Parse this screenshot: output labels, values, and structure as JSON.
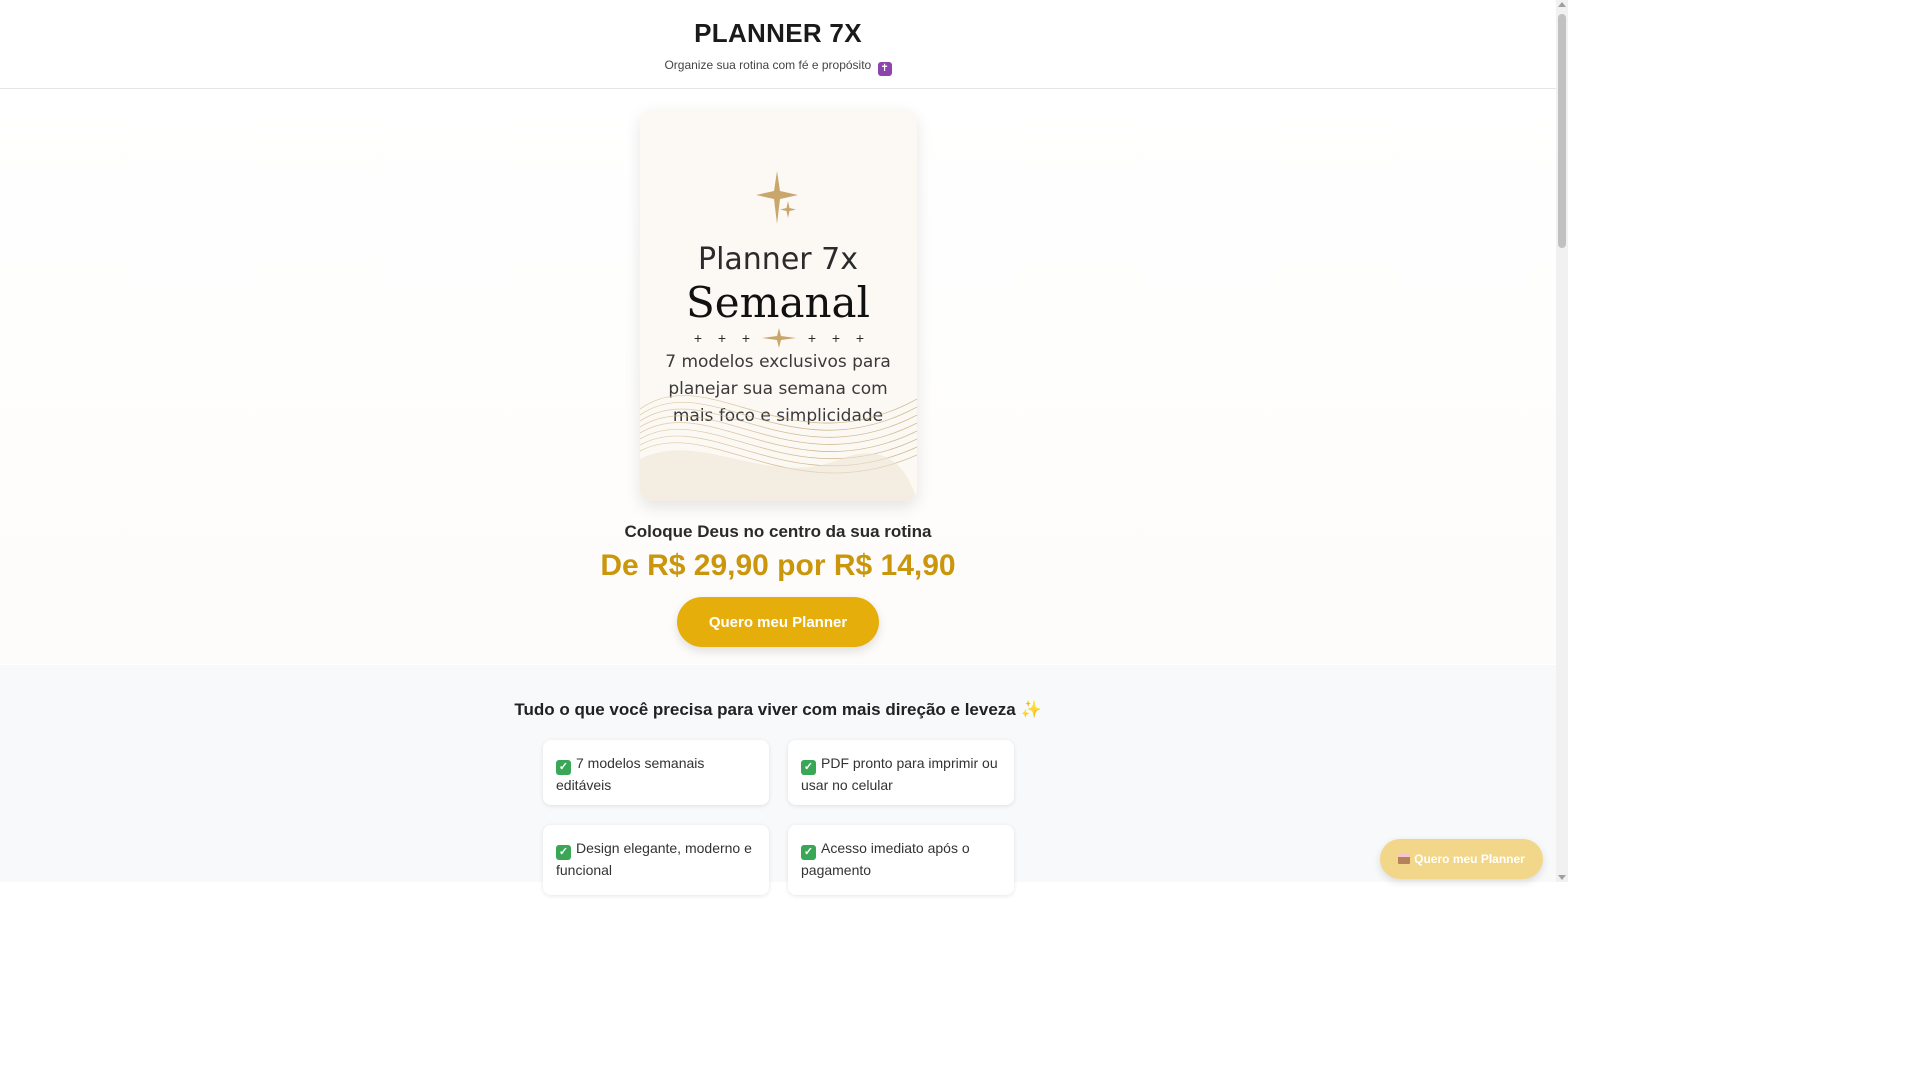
{
  "header": {
    "title": "PLANNER 7X",
    "subtitle": "Organize sua rotina com fé e propósito",
    "subtitle_icon": "latin-cross-icon"
  },
  "hero": {
    "cover": {
      "line1": "Planner 7x",
      "line2": "Semanal",
      "desc1": "7 modelos exclusivos para",
      "desc2": "planejar sua semana com",
      "desc3": "mais foco e simplicidade"
    },
    "tagline": "Coloque Deus no centro da sua rotina",
    "price": "De R$ 29,90 por R$ 14,90",
    "cta_label": "Quero meu Planner"
  },
  "features": {
    "title": "Tudo o que você precisa para viver com mais direção e leveza ✨",
    "items": [
      {
        "text": "7 modelos semanais editáveis",
        "icon": "check-mark-icon"
      },
      {
        "text": "PDF pronto para imprimir ou usar no celular",
        "icon": "check-mark-icon"
      },
      {
        "text": "Design elegante, moderno e funcional",
        "icon": "check-mark-icon"
      },
      {
        "text": "Acesso imediato após o pagamento",
        "icon": "check-mark-icon"
      }
    ]
  },
  "floating_cta": {
    "label": "Quero meu Planner",
    "icon": "cake-icon"
  },
  "colors": {
    "accent": "#e6ae0b",
    "price": "#c9960c",
    "floating_button": "#f2d78a"
  }
}
